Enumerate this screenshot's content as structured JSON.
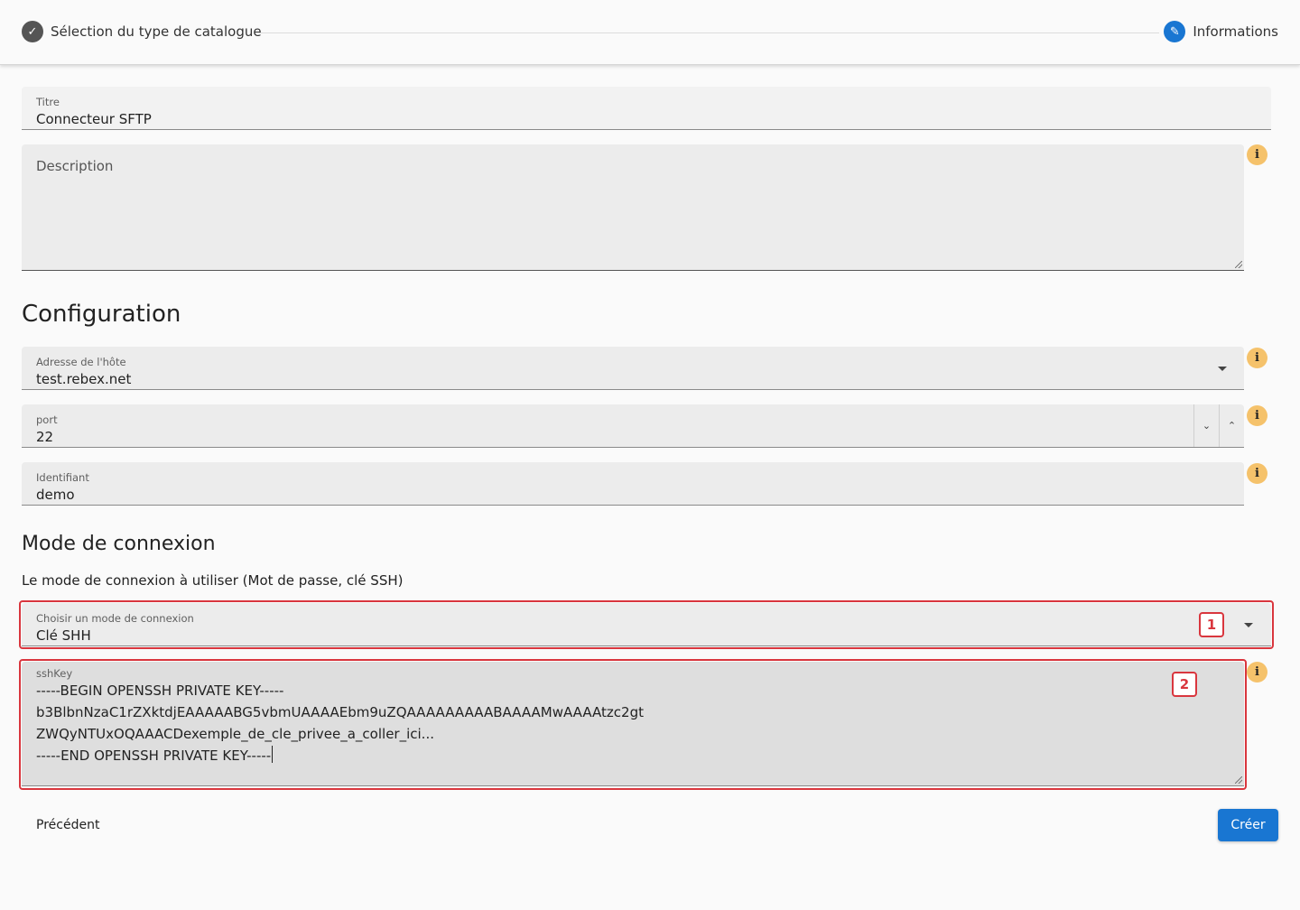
{
  "stepper": {
    "step1_label": "Sélection du type de catalogue",
    "step1_icon": "check-icon",
    "step2_label": "Informations",
    "step2_icon": "pencil-icon"
  },
  "form": {
    "title": {
      "label": "Titre",
      "value": "Connecteur SFTP"
    },
    "description": {
      "placeholder": "Description"
    }
  },
  "configuration": {
    "heading": "Configuration",
    "host": {
      "label": "Adresse de l'hôte",
      "value": "test.rebex.net"
    },
    "port": {
      "label": "port",
      "value": "22"
    },
    "username": {
      "label": "Identifiant",
      "value": "demo"
    }
  },
  "connection_mode": {
    "heading": "Mode de connexion",
    "description": "Le mode de connexion à utiliser (Mot de passe, clé SSH)",
    "select": {
      "label": "Choisir un mode de connexion",
      "value": "Clé SHH"
    },
    "ssh_key": {
      "label": "sshKey",
      "lines": [
        "-----BEGIN OPENSSH PRIVATE KEY-----",
        "b3BlbnNzaC1rZXktdjEAAAAABG5vbmUAAAAEbm9uZQAAAAAAAAABAAAAMwAAAAtzc2gt",
        "ZWQyNTUxOQAAACDexemple_de_cle_privee_a_coller_ici...",
        "-----END OPENSSH PRIVATE KEY-----"
      ]
    }
  },
  "annotations": {
    "badge1": "1",
    "badge2": "2"
  },
  "actions": {
    "previous": "Précédent",
    "create": "Créer"
  },
  "colors": {
    "primary": "#1976d2",
    "info": "#f5c26b",
    "highlight": "#d9363e"
  }
}
